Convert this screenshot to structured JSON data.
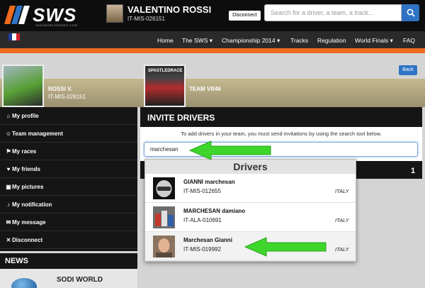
{
  "brand": {
    "logo_text": "SWS",
    "logo_sub": "SODIWORLDSERIES.COM"
  },
  "user": {
    "name": "VALENTINO ROSSI",
    "id": "IT-MIS-026151",
    "disconnect_label": "Disconnect"
  },
  "search": {
    "placeholder": "Search for a driver, a team, a track..."
  },
  "nav": {
    "flag_colors": [
      "#1f3c9b",
      "#ffffff",
      "#d3202a"
    ],
    "items": [
      "Home",
      "The SWS ▾",
      "Championship 2014 ▾",
      "Tracks",
      "Regulation",
      "World Finals ▾",
      "FAQ"
    ]
  },
  "accent": "#ef6a1f",
  "back_label": "Back",
  "profile": {
    "name": "ROSSI V.",
    "id": "IT-MIS-026151"
  },
  "team": {
    "name": "TEAM VR46",
    "photo_caption": "SPASTLEDRACE"
  },
  "sidebar": {
    "items": [
      {
        "icon": "home-icon",
        "glyph": "⌂",
        "label": "My profile"
      },
      {
        "icon": "user-icon",
        "glyph": "☺",
        "label": "Team management"
      },
      {
        "icon": "flag-icon",
        "glyph": "⚑",
        "label": "My races"
      },
      {
        "icon": "heart-icon",
        "glyph": "♥",
        "label": "My friends"
      },
      {
        "icon": "picture-icon",
        "glyph": "▣",
        "label": "My pictures"
      },
      {
        "icon": "bell-icon",
        "glyph": "♪",
        "label": "My notification"
      },
      {
        "icon": "envelope-icon",
        "glyph": "✉",
        "label": "My message"
      },
      {
        "icon": "close-icon",
        "glyph": "✕",
        "label": "Disconnect"
      }
    ]
  },
  "news": {
    "heading": "NEWS",
    "item_title": "SODI WORLD"
  },
  "invite": {
    "title": "INVITE DRIVERS",
    "instructions": "To add drivers in your team, you must send invitations by using the search tool below.",
    "input_value": "marchesan",
    "results_count": "1"
  },
  "dropdown": {
    "header": "Drivers",
    "drivers": [
      {
        "name": "GIANNI marchesan",
        "id": "IT-MIS-012655",
        "country": "ITALY",
        "thumb": "helmet"
      },
      {
        "name": "MARCHESAN damiano",
        "id": "IT-ALA-010691",
        "country": "ITALY",
        "thumb": "podium"
      },
      {
        "name": "Marchesan Gianni",
        "id": "IT-MIS-019992",
        "country": "ITALY",
        "thumb": "face"
      }
    ]
  },
  "annotation_color": "#3ed62b"
}
